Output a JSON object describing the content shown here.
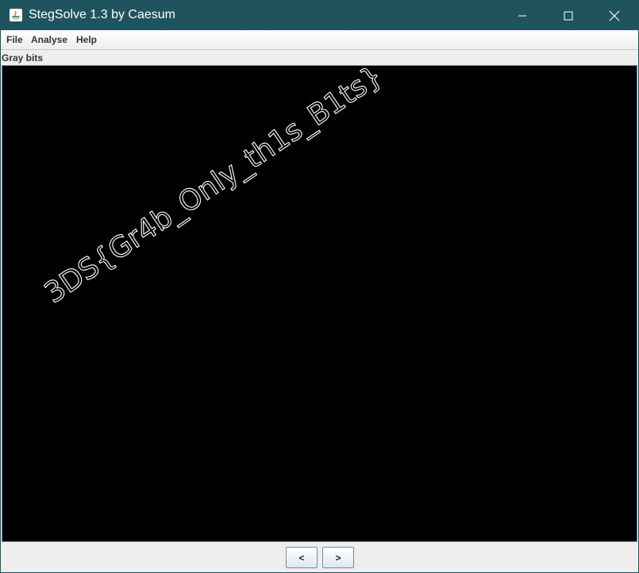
{
  "window": {
    "title": "StegSolve 1.3 by Caesum",
    "colors": {
      "titlebar": "#1f545e",
      "image_bg": "#000000",
      "stego_text": "#ffffff"
    }
  },
  "menu": {
    "items": [
      {
        "label": "File"
      },
      {
        "label": "Analyse"
      },
      {
        "label": "Help"
      }
    ]
  },
  "status": {
    "label": "Gray bits"
  },
  "image": {
    "hidden_text": "3DS{Gr4b_Only_th1s_B1ts}"
  },
  "nav": {
    "prev_label": "<",
    "next_label": ">"
  },
  "icons": [
    "java-app-icon",
    "minimize-icon",
    "maximize-icon",
    "close-icon"
  ]
}
